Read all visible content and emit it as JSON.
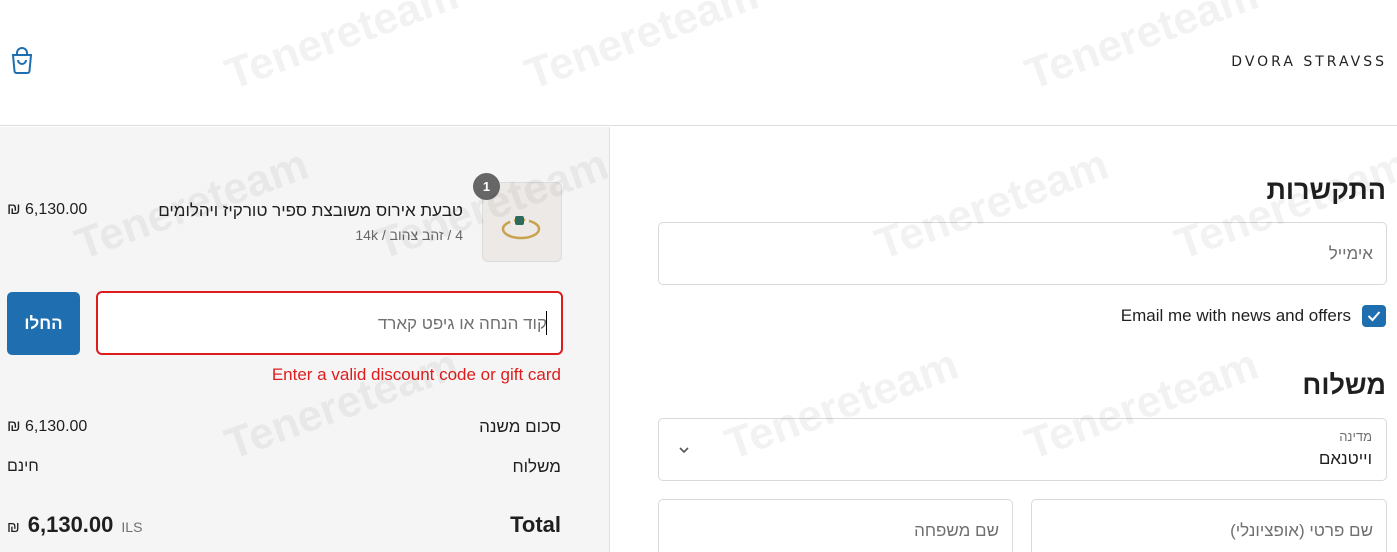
{
  "header": {
    "logo": "DVORA STRAVSS",
    "bag_icon": "shopping-bag-icon"
  },
  "summary": {
    "product": {
      "name": "טבעת אירוס משובצת ספיר טורקיז ויהלומים",
      "variant": "4 / זהב צהוב / 14k",
      "price": "₪ 6,130.00",
      "quantity": "1"
    },
    "discount": {
      "placeholder": "קוד הנחה או גיפט קארד",
      "apply_label": "החלו",
      "error": "Enter a valid discount code or gift card"
    },
    "subtotal": {
      "label": "סכום משנה",
      "value": "₪ 6,130.00"
    },
    "shipping": {
      "label": "משלוח",
      "value": "חינם"
    },
    "total": {
      "label": "Total",
      "symbol": "₪",
      "amount": "6,130.00",
      "currency": "ILS"
    }
  },
  "form": {
    "contact": {
      "title": "התקשרות",
      "email_placeholder": "אימייל",
      "newsletter_label": "Email me with news and offers",
      "newsletter_checked": true
    },
    "shipping": {
      "title": "משלוח",
      "country_label": "מדינה",
      "country_value": "וייטנאם",
      "first_name_placeholder": "שם פרטי (אופציונלי)",
      "last_name_placeholder": "שם משפחה"
    }
  },
  "colors": {
    "accent": "#1f6fb0",
    "error": "#dd1d1d"
  },
  "watermark": "Tenereteam"
}
